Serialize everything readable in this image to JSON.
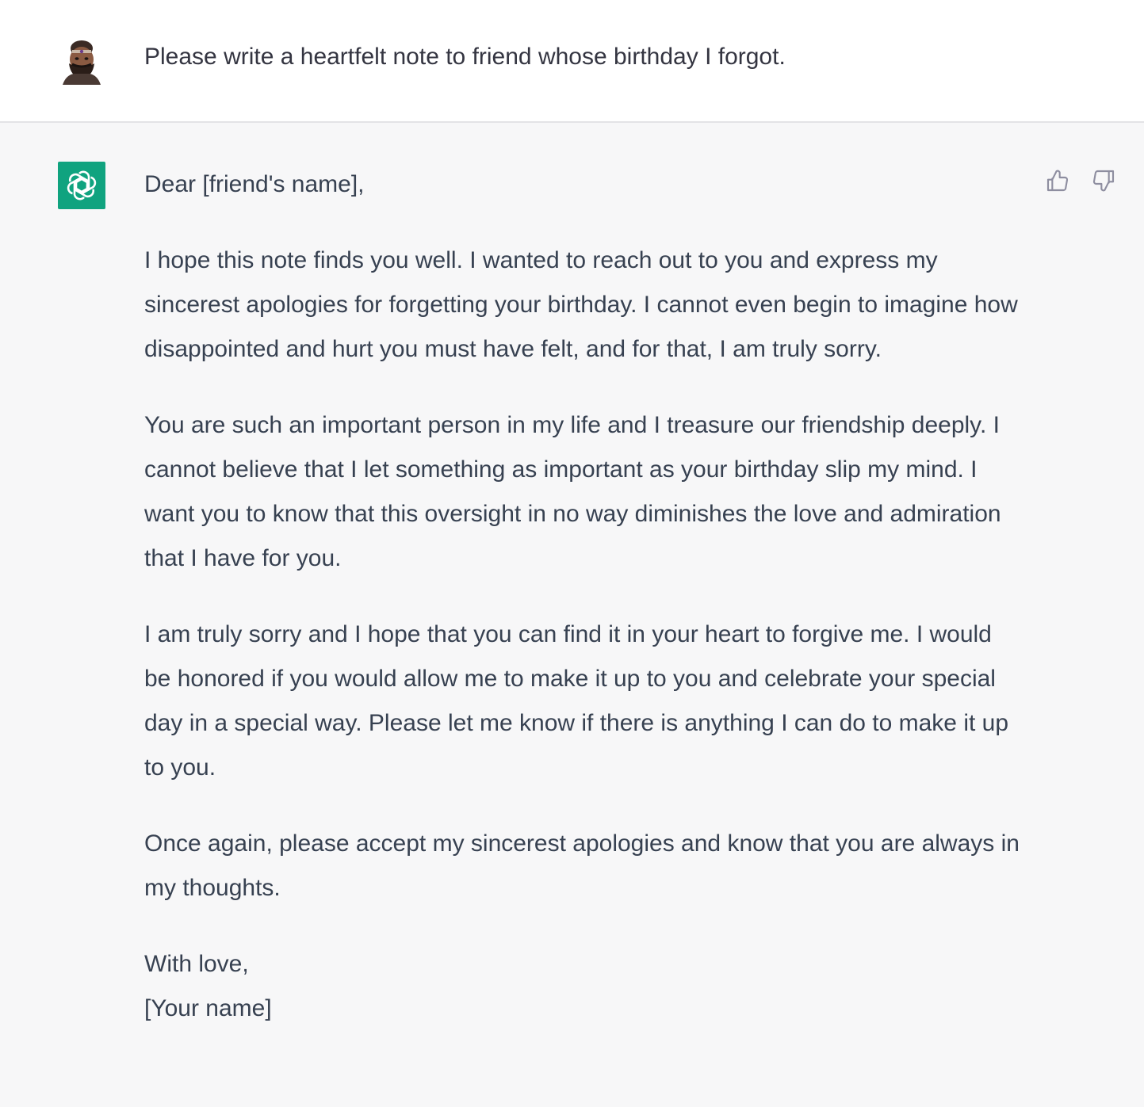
{
  "user_message": {
    "text": "Please write a heartfelt note to friend whose birthday I forgot."
  },
  "assistant_message": {
    "greeting": "Dear [friend's name],",
    "paragraphs": [
      "I hope this note finds you well. I wanted to reach out to you and express my sincerest apologies for forgetting your birthday. I cannot even begin to imagine how disappointed and hurt you must have felt, and for that, I am truly sorry.",
      "You are such an important person in my life and I treasure our friendship deeply. I cannot believe that I let something as important as your birthday slip my mind. I want you to know that this oversight in no way diminishes the love and admiration that I have for you.",
      "I am truly sorry and I hope that you can find it in your heart to forgive me. I would be honored if you would allow me to make it up to you and celebrate your special day in a special way. Please let me know if there is anything I can do to make it up to you.",
      "Once again, please accept my sincerest apologies and know that you are always in my thoughts."
    ],
    "closing": "With love,",
    "signature": "[Your name]"
  },
  "feedback": {
    "thumbs_up_icon": "thumbs-up-icon",
    "thumbs_down_icon": "thumbs-down-icon"
  },
  "colors": {
    "assistant_avatar_bg": "#10a37f",
    "assistant_row_bg": "#f7f7f8",
    "user_row_bg": "#ffffff",
    "text": "#374151"
  }
}
